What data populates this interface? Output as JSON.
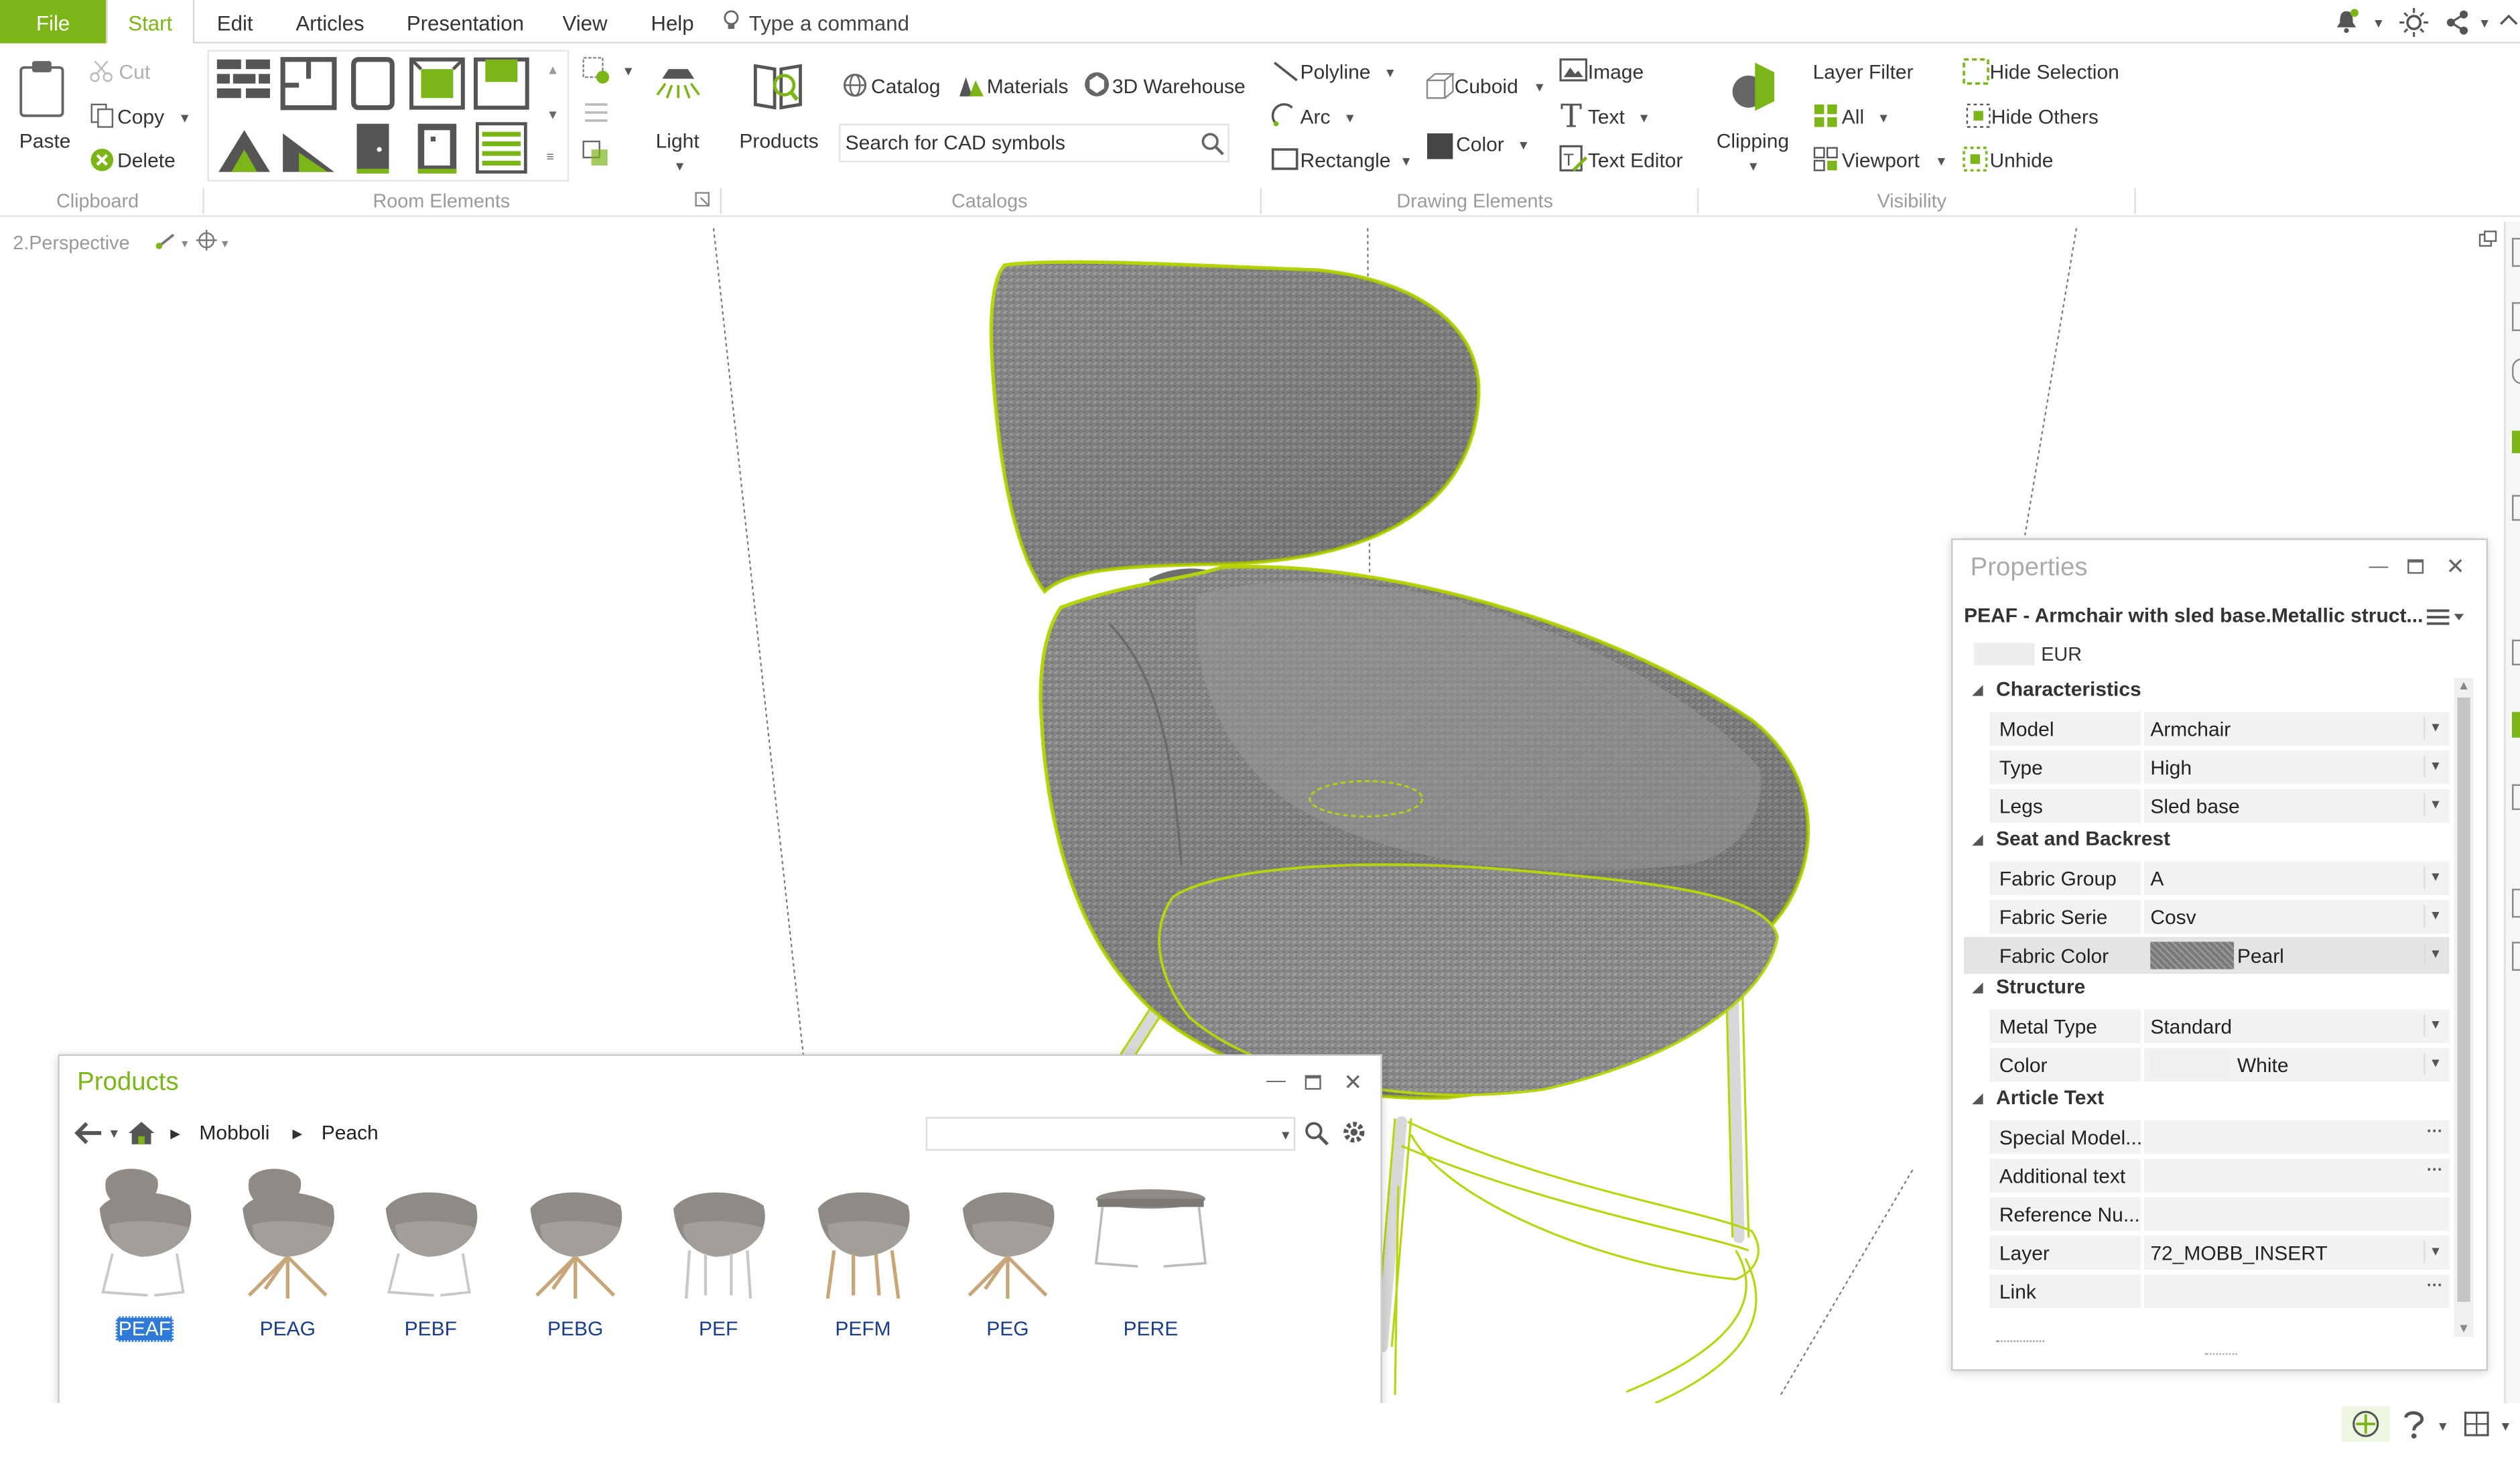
{
  "menu": {
    "file": "File",
    "tabs": [
      "Start",
      "Edit",
      "Articles",
      "Presentation",
      "View",
      "Help"
    ],
    "command_placeholder": "Type a command"
  },
  "ribbon": {
    "clipboard": {
      "paste": "Paste",
      "cut": "Cut",
      "copy": "Copy",
      "delete": "Delete",
      "group": "Clipboard"
    },
    "room_elements": {
      "group": "Room Elements"
    },
    "light": "Light",
    "products": "Products",
    "catalogs": {
      "catalog": "Catalog",
      "materials": "Materials",
      "warehouse": "3D Warehouse",
      "search_placeholder": "Search for CAD symbols",
      "group": "Catalogs"
    },
    "drawing": {
      "polyline": "Polyline",
      "arc": "Arc",
      "rectangle": "Rectangle",
      "cuboid": "Cuboid",
      "color": "Color",
      "image": "Image",
      "text": "Text",
      "text_editor": "Text Editor",
      "group": "Drawing Elements"
    },
    "clipping": "Clipping",
    "visibility": {
      "layer_filter": "Layer Filter",
      "all": "All",
      "viewport": "Viewport",
      "hide_selection": "Hide Selection",
      "hide_others": "Hide Others",
      "unhide": "Unhide",
      "group": "Visibility"
    }
  },
  "viewport": {
    "label": "2.Perspective"
  },
  "properties": {
    "title": "Properties",
    "article": "PEAF - Armchair with sled base.Metallic struct...",
    "currency": "EUR",
    "sections": [
      {
        "name": "Characteristics",
        "rows": [
          {
            "key": "Model",
            "value": "Armchair"
          },
          {
            "key": "Type",
            "value": "High"
          },
          {
            "key": "Legs",
            "value": "Sled base"
          }
        ]
      },
      {
        "name": "Seat and Backrest",
        "rows": [
          {
            "key": "Fabric Group",
            "value": "A"
          },
          {
            "key": "Fabric Serie",
            "value": "Cosv"
          },
          {
            "key": "Fabric Color",
            "value": "Pearl"
          }
        ]
      },
      {
        "name": "Structure",
        "rows": [
          {
            "key": "Metal Type",
            "value": "Standard"
          },
          {
            "key": "Color",
            "value": "White"
          }
        ]
      },
      {
        "name": "Article Text",
        "rows": [
          {
            "key": "Special Model...",
            "value": ""
          },
          {
            "key": "Additional text",
            "value": ""
          },
          {
            "key": "Reference Nu...",
            "value": ""
          },
          {
            "key": "Layer",
            "value": "72_MOBB_INSERT"
          },
          {
            "key": "Link",
            "value": ""
          }
        ]
      }
    ]
  },
  "products_panel": {
    "title": "Products",
    "breadcrumb": [
      "Mobboli",
      "Peach"
    ],
    "items": [
      "PEAF",
      "PEAG",
      "PEBF",
      "PEBG",
      "PEF",
      "PEFM",
      "PEG",
      "PERE"
    ]
  },
  "colors": {
    "accent": "#7cb518",
    "fabric": "#8a8a8a",
    "selection": "#b8d40a"
  }
}
